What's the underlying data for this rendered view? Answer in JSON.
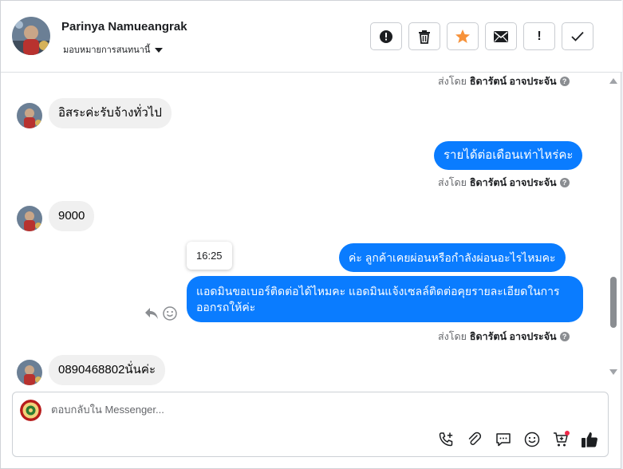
{
  "header": {
    "contact_name": "Parinya Namueangrak",
    "assign_label": "มอบหมายการสนทนานี้",
    "actions": [
      {
        "icon": "alert-circle-icon"
      },
      {
        "icon": "trash-icon"
      },
      {
        "icon": "star-icon"
      },
      {
        "icon": "envelope-icon"
      },
      {
        "icon": "exclamation-icon",
        "text": "!"
      },
      {
        "icon": "check-icon"
      }
    ]
  },
  "chat": {
    "sent_by_prefix": "ส่งโดย",
    "sender_name": "ธิดารัตน์ อาจประจัน",
    "help_glyph": "?",
    "messages": [
      {
        "from": "customer",
        "text": "อิสระค่ะรับจ้างทั่วไป"
      },
      {
        "from": "page",
        "text": "รายได้ต่อเดือนเท่าไหร่คะ"
      },
      {
        "from": "customer",
        "text": "9000"
      },
      {
        "from": "page",
        "text": "ค่ะ ลูกค้าเคยผ่อนหรือกำลังผ่อนอะไรไหมคะ"
      },
      {
        "from": "page",
        "text": "แอดมินขอเบอร์ติดต่อได้ไหมคะ แอดมินแจ้งเซลล์ติดต่อคุยรายละเอียดในการออกรถให้ค่ะ"
      },
      {
        "from": "customer",
        "text": "0890468802นั่นค่ะ"
      }
    ],
    "timestamp_tooltip": "16:25"
  },
  "composer": {
    "placeholder": "ตอบกลับใน Messenger...",
    "tools": [
      "add-call-icon",
      "paperclip-icon",
      "saved-reply-icon",
      "emoji-icon",
      "cart-icon",
      "thumbs-up-icon"
    ]
  },
  "colors": {
    "outgoing_bubble": "#0a7cff",
    "incoming_bubble": "#f0f0f0",
    "star": "#f7923a",
    "notification_dot": "#f02849"
  }
}
